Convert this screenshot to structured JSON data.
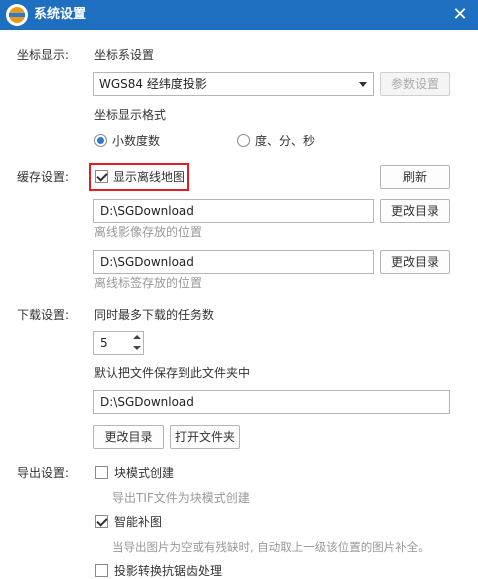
{
  "window": {
    "title": "系统设置",
    "close_glyph": "✕"
  },
  "coord": {
    "section_label": "坐标显示:",
    "system_label": "坐标系设置",
    "system_value": "WGS84 经纬度投影",
    "params_button": "参数设置",
    "format_label": "坐标显示格式",
    "format_options": [
      "小数度数",
      "度、分、秒"
    ],
    "format_selected": "小数度数"
  },
  "cache": {
    "section_label": "缓存设置:",
    "show_offline_label": "显示离线地图",
    "show_offline_checked": true,
    "refresh_button": "刷新",
    "image_path": "D:\\SGDownload",
    "image_path_hint": "离线影像存放的位置",
    "label_path": "D:\\SGDownload",
    "label_path_hint": "离线标签存放的位置",
    "change_dir_button": "更改目录"
  },
  "download": {
    "section_label": "下载设置:",
    "max_tasks_label": "同时最多下载的任务数",
    "max_tasks_value": "5",
    "default_folder_label": "默认把文件保存到此文件夹中",
    "default_folder_value": "D:\\SGDownload",
    "change_dir_button": "更改目录",
    "open_folder_button": "打开文件夹"
  },
  "export": {
    "section_label": "导出设置:",
    "block_mode_label": "块模式创建",
    "block_mode_checked": false,
    "block_mode_hint": "导出TIF文件为块模式创建",
    "smart_fill_label": "智能补图",
    "smart_fill_checked": true,
    "smart_fill_hint": "当导出图片为空或有残缺时, 自动取上一级该位置的图片补全。",
    "antialias_label": "投影转换抗锯齿处理",
    "antialias_checked": false
  },
  "colors": {
    "titlebar": "#1f6fc0",
    "highlight_border": "#e02020",
    "radio_accent": "#2b7bd1"
  }
}
